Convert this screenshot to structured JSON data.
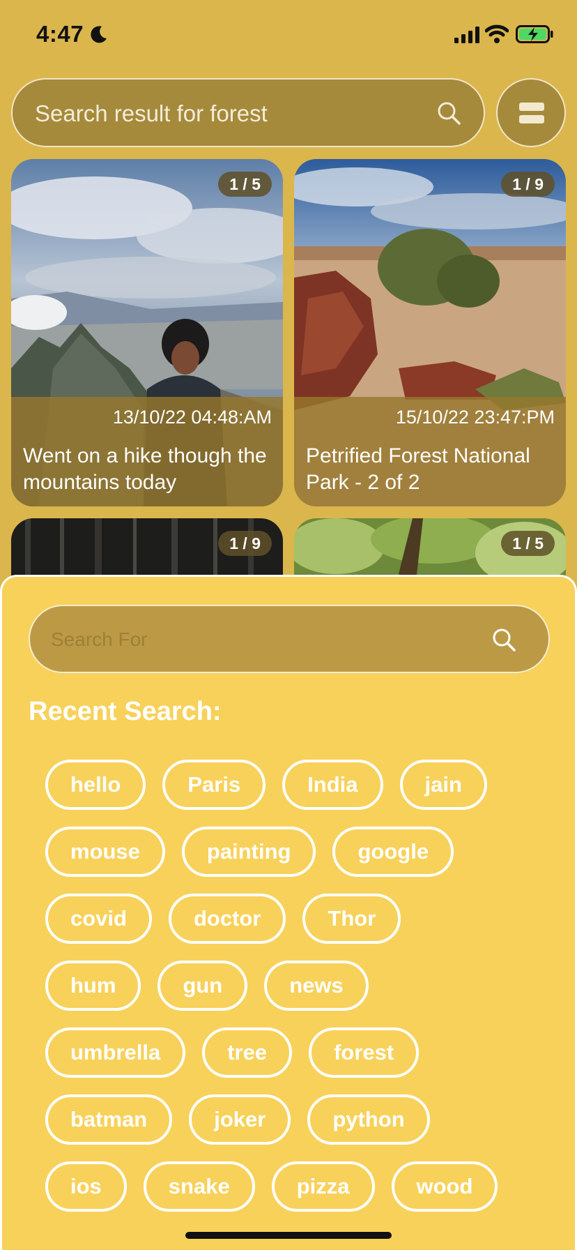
{
  "status_bar": {
    "time": "4:47",
    "icons": [
      "moon-icon",
      "cellular-signal-icon",
      "wifi-icon",
      "battery-charging-icon"
    ]
  },
  "top_search": {
    "text": "Search result for forest",
    "icon": "search-icon"
  },
  "layout_toggle": {
    "icon": "list-layout-icon"
  },
  "results": [
    {
      "count": "1 / 5",
      "date": "13/10/22 04:48:AM",
      "caption": "Went on a hike though the mountains today"
    },
    {
      "count": "1 / 9",
      "date": "15/10/22 23:47:PM",
      "caption": "Petrified Forest National Park - 2 of 2"
    },
    {
      "count": "1 / 9"
    },
    {
      "count": "1 / 5"
    }
  ],
  "sheet": {
    "search_placeholder": "Search For",
    "recent_title": "Recent Search:",
    "chip_rows": [
      [
        "hello",
        "Paris",
        "India",
        "jain"
      ],
      [
        "mouse",
        "painting",
        "google"
      ],
      [
        "covid",
        "doctor",
        "Thor"
      ],
      [
        "hum",
        "gun",
        "news"
      ],
      [
        "umbrella",
        "tree",
        "forest"
      ],
      [
        "batman",
        "joker",
        "python"
      ],
      [
        "ios",
        "snake",
        "pizza",
        "wood"
      ]
    ]
  },
  "colors": {
    "background": "#dbb64c",
    "sheet": "#f8d15a",
    "search_fill": "#a58a3c",
    "chip_border": "#ffffff"
  }
}
